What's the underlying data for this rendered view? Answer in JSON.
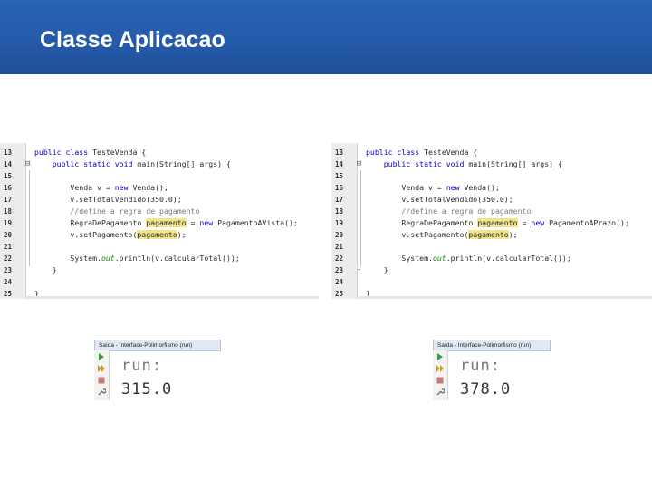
{
  "slide": {
    "title": "Classe Aplicacao"
  },
  "editors": [
    {
      "lines": [
        {
          "n": "13",
          "fold": "",
          "code": [
            {
              "t": "public class ",
              "c": "kw"
            },
            {
              "t": "TesteVenda {",
              "c": ""
            }
          ]
        },
        {
          "n": "14",
          "fold": "⊟",
          "code": [
            {
              "t": "    ",
              "c": ""
            },
            {
              "t": "public static void ",
              "c": "kw"
            },
            {
              "t": "main(String[] args) {",
              "c": ""
            }
          ]
        },
        {
          "n": "15",
          "fold": "",
          "code": []
        },
        {
          "n": "16",
          "fold": "",
          "code": [
            {
              "t": "        Venda v = ",
              "c": ""
            },
            {
              "t": "new ",
              "c": "kw"
            },
            {
              "t": "Venda();",
              "c": ""
            }
          ]
        },
        {
          "n": "17",
          "fold": "",
          "code": [
            {
              "t": "        v.setTotalVendido(350.0);",
              "c": ""
            }
          ]
        },
        {
          "n": "18",
          "fold": "",
          "code": [
            {
              "t": "        //define a regra de pagamento",
              "c": "cm"
            }
          ]
        },
        {
          "n": "19",
          "fold": "",
          "code": [
            {
              "t": "        RegraDePagamento ",
              "c": ""
            },
            {
              "t": "pagamento",
              "c": "hl"
            },
            {
              "t": " = ",
              "c": ""
            },
            {
              "t": "new ",
              "c": "kw"
            },
            {
              "t": "PagamentoAVista();",
              "c": ""
            }
          ]
        },
        {
          "n": "20",
          "fold": "",
          "code": [
            {
              "t": "        v.setPagamento(",
              "c": ""
            },
            {
              "t": "pagamento",
              "c": "hl"
            },
            {
              "t": ");",
              "c": ""
            }
          ]
        },
        {
          "n": "21",
          "fold": "",
          "code": []
        },
        {
          "n": "22",
          "fold": "",
          "code": [
            {
              "t": "        System.",
              "c": ""
            },
            {
              "t": "out",
              "c": "fld"
            },
            {
              "t": ".println(v.calcularTotal());",
              "c": ""
            }
          ]
        },
        {
          "n": "23",
          "fold": "",
          "code": [
            {
              "t": "    }",
              "c": ""
            }
          ]
        },
        {
          "n": "24",
          "fold": "",
          "code": []
        },
        {
          "n": "25",
          "fold": "",
          "code": [
            {
              "t": "}",
              "c": ""
            }
          ]
        }
      ]
    },
    {
      "lines": [
        {
          "n": "13",
          "fold": "",
          "code": [
            {
              "t": "public class ",
              "c": "kw"
            },
            {
              "t": "TesteVenda {",
              "c": ""
            }
          ]
        },
        {
          "n": "14",
          "fold": "⊟",
          "code": [
            {
              "t": "    ",
              "c": ""
            },
            {
              "t": "public static void ",
              "c": "kw"
            },
            {
              "t": "main(String[] args) {",
              "c": ""
            }
          ]
        },
        {
          "n": "15",
          "fold": "",
          "code": []
        },
        {
          "n": "16",
          "fold": "",
          "code": [
            {
              "t": "        Venda v = ",
              "c": ""
            },
            {
              "t": "new ",
              "c": "kw"
            },
            {
              "t": "Venda();",
              "c": ""
            }
          ]
        },
        {
          "n": "17",
          "fold": "",
          "code": [
            {
              "t": "        v.setTotalVendido(350.0);",
              "c": ""
            }
          ]
        },
        {
          "n": "18",
          "fold": "",
          "code": [
            {
              "t": "        //define a regra de pagamento",
              "c": "cm"
            }
          ]
        },
        {
          "n": "19",
          "fold": "",
          "code": [
            {
              "t": "        RegraDePagamento ",
              "c": ""
            },
            {
              "t": "pagamento",
              "c": "hl"
            },
            {
              "t": " = ",
              "c": ""
            },
            {
              "t": "new ",
              "c": "kw"
            },
            {
              "t": "PagamentoAPrazo();",
              "c": ""
            }
          ]
        },
        {
          "n": "20",
          "fold": "",
          "code": [
            {
              "t": "        v.setPagamento(",
              "c": ""
            },
            {
              "t": "pagamento",
              "c": "hl"
            },
            {
              "t": ");",
              "c": ""
            }
          ]
        },
        {
          "n": "21",
          "fold": "",
          "code": []
        },
        {
          "n": "22",
          "fold": "",
          "code": [
            {
              "t": "        System.",
              "c": ""
            },
            {
              "t": "out",
              "c": "fld"
            },
            {
              "t": ".println(v.calcularTotal());",
              "c": ""
            }
          ]
        },
        {
          "n": "23",
          "fold": "-",
          "code": [
            {
              "t": "    }",
              "c": ""
            }
          ]
        },
        {
          "n": "24",
          "fold": "",
          "code": []
        },
        {
          "n": "25",
          "fold": "",
          "code": [
            {
              "t": "}",
              "c": ""
            }
          ]
        }
      ]
    }
  ],
  "outputs": [
    {
      "tab": "Saída - Interface-Polimorfismo (run)",
      "run": "run:",
      "value": "315.0"
    },
    {
      "tab": "Saída - Interface-Polimorfismo (run)",
      "run": "run:",
      "value": "378.0"
    }
  ],
  "icons": {
    "run_icon": "play-arrow-icon",
    "rerun_icon": "double-arrow-icon",
    "stop_icon": "stop-icon",
    "settings_icon": "wrench-icon"
  },
  "colors": {
    "header": "#245aa8",
    "keyword": "#0000cc",
    "highlight": "#f2e48a",
    "comment": "#7a7a7a"
  }
}
